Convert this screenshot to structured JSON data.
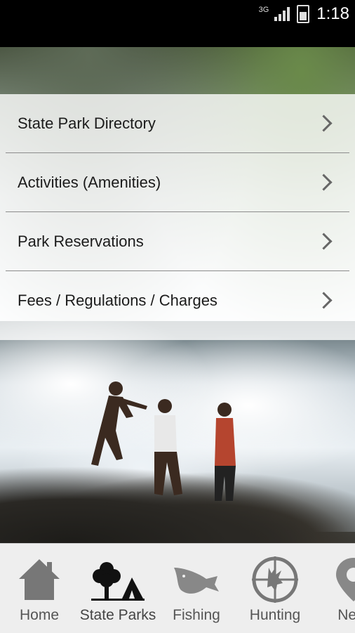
{
  "status_bar": {
    "network": "3G",
    "time": "1:18"
  },
  "menu": {
    "items": [
      {
        "label": "State Park Directory"
      },
      {
        "label": "Activities (Amenities)"
      },
      {
        "label": "Park Reservations"
      },
      {
        "label": "Fees / Regulations / Charges"
      }
    ]
  },
  "tabs": [
    {
      "label": "Home",
      "icon": "house-icon"
    },
    {
      "label": "State Parks",
      "icon": "tree-tent-icon"
    },
    {
      "label": "Fishing",
      "icon": "fish-icon"
    },
    {
      "label": "Hunting",
      "icon": "crosshair-deer-icon"
    },
    {
      "label": "Near",
      "icon": "location-pin-icon"
    }
  ]
}
